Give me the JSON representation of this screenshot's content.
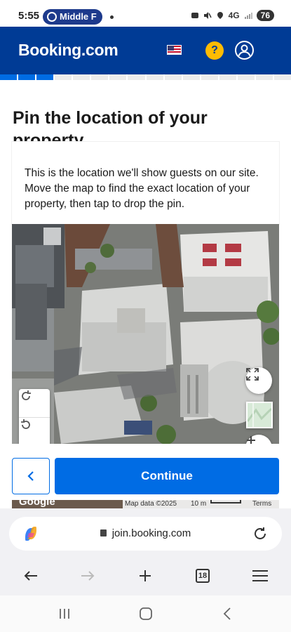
{
  "status_bar": {
    "time": "5:55",
    "notification_pill": "Middle F",
    "network": "4G",
    "battery": "76"
  },
  "header": {
    "logo": "Booking.com",
    "help_label": "?",
    "flag_icon": "us-flag-icon",
    "account_icon": "account-icon"
  },
  "progress": {
    "completed_steps": 3,
    "total_steps": 16,
    "accent": "#006ce4"
  },
  "main": {
    "title": "Pin the location of your property",
    "description": "This is the location we'll show guests on our site. Move the map to find the exact location of your property, then tap to drop the pin."
  },
  "map": {
    "type": "satellite",
    "controls": [
      "rotate-clockwise-icon",
      "rotate-counterclockwise-icon",
      "fullscreen-icon",
      "map-layer-icon",
      "zoom-in-icon"
    ],
    "attribution": {
      "logo": "Google",
      "map_data": "Map data ©2025",
      "scale": "10 m",
      "terms": "Terms"
    }
  },
  "actions": {
    "back_icon": "chevron-left-icon",
    "continue_label": "Continue"
  },
  "browser": {
    "url": "join.booking.com",
    "tab_count": "18",
    "icons": [
      "copilot-icon",
      "lock-icon",
      "reload-icon",
      "back-arrow-icon",
      "forward-arrow-icon",
      "new-tab-icon",
      "tabs-icon",
      "menu-icon"
    ]
  },
  "system_nav": {
    "icons": [
      "recents-icon",
      "home-icon",
      "system-back-icon"
    ]
  },
  "colors": {
    "brand_blue": "#003b95",
    "primary_button": "#006ce4",
    "help_yellow": "#febb02"
  }
}
